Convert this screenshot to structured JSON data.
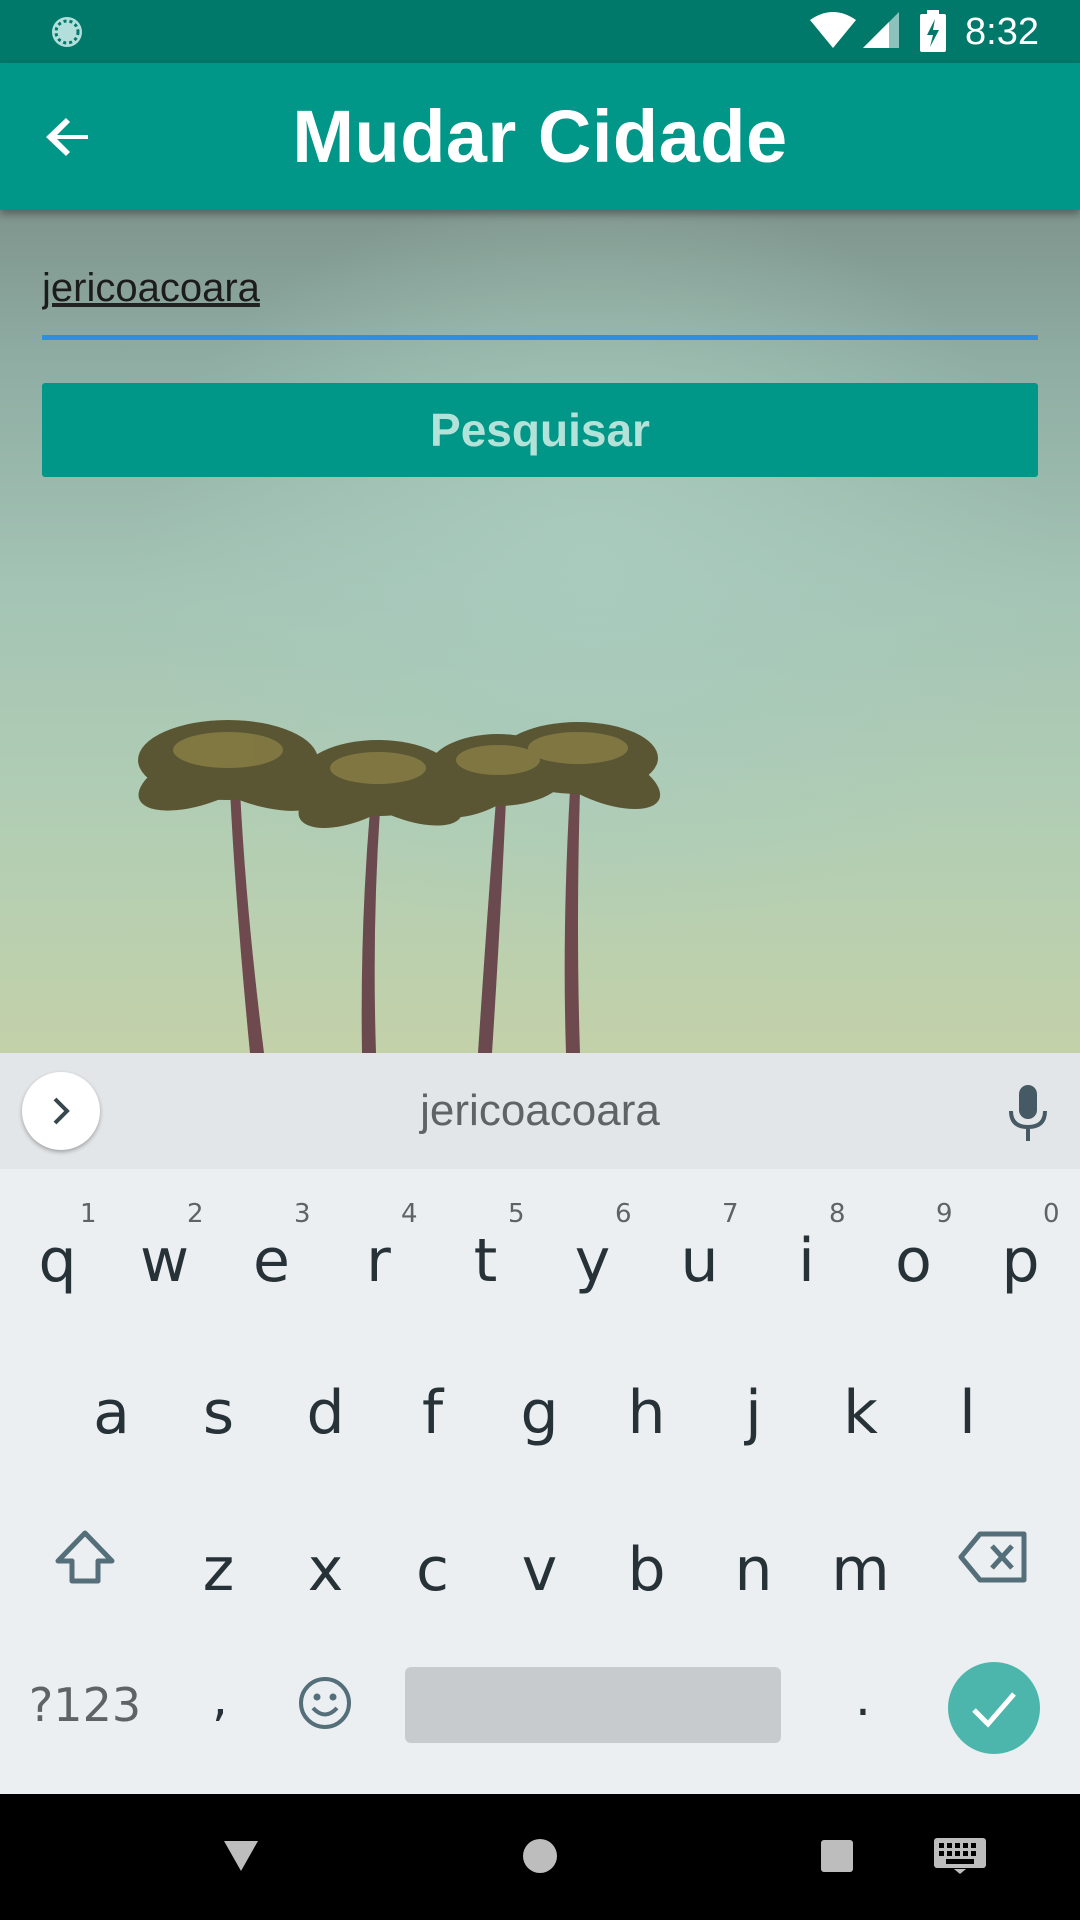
{
  "status_bar": {
    "time": "8:32",
    "icons": [
      "loading-spinner-icon",
      "wifi-icon",
      "cell-signal-icon",
      "battery-charging-icon"
    ]
  },
  "app_bar": {
    "title": "Mudar Cidade",
    "back_icon": "arrow-back-icon"
  },
  "form": {
    "city_value": "jericoacoara",
    "search_button_label": "Pesquisar"
  },
  "keyboard": {
    "suggestion": "jericoacoara",
    "row1": [
      {
        "key": "q",
        "hint": "1"
      },
      {
        "key": "w",
        "hint": "2"
      },
      {
        "key": "e",
        "hint": "3"
      },
      {
        "key": "r",
        "hint": "4"
      },
      {
        "key": "t",
        "hint": "5"
      },
      {
        "key": "y",
        "hint": "6"
      },
      {
        "key": "u",
        "hint": "7"
      },
      {
        "key": "i",
        "hint": "8"
      },
      {
        "key": "o",
        "hint": "9"
      },
      {
        "key": "p",
        "hint": "0"
      }
    ],
    "row2": [
      "a",
      "s",
      "d",
      "f",
      "g",
      "h",
      "j",
      "k",
      "l"
    ],
    "row3": [
      "z",
      "x",
      "c",
      "v",
      "b",
      "n",
      "m"
    ],
    "symbols_label": "?123",
    "comma_label": ",",
    "period_label": "."
  },
  "colors": {
    "status_bar": "#00796b",
    "primary": "#009688",
    "input_underline": "#2f8ee0",
    "enter_key": "#4db6ac"
  }
}
